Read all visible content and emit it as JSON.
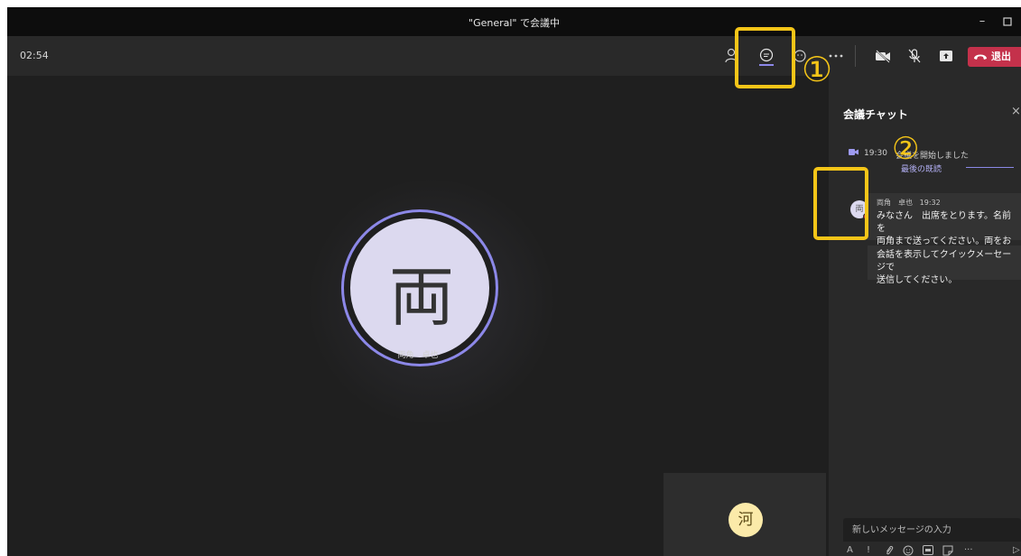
{
  "window": {
    "title": "\"General\" で会議中"
  },
  "meeting": {
    "timer": "02:54",
    "leave_label": "退出"
  },
  "stage": {
    "main_participant": {
      "avatar_initial": "両",
      "name": "両角　卓也"
    },
    "mini_tile": {
      "avatar_initial": "河"
    }
  },
  "chat": {
    "title": "会議チャット",
    "event": {
      "time": "19:30",
      "text": "会議を開始しました"
    },
    "last_read_label": "最後の既読",
    "message": {
      "avatar_initial": "両",
      "sender": "両角　卓也",
      "time": "19:32",
      "line1": "みなさん　出席をとります。名前を",
      "line2": "両角まで送ってください。両をおして",
      "line3": "会話を表示してクイックメーセージで",
      "line4": "送信してください。"
    },
    "compose_placeholder": "新しいメッセージの入力"
  },
  "annotations": {
    "marker1": "①",
    "marker2": "②",
    "color": "#f5c518"
  },
  "colors": {
    "accent": "#8c88e8",
    "leave": "#c4314b"
  }
}
